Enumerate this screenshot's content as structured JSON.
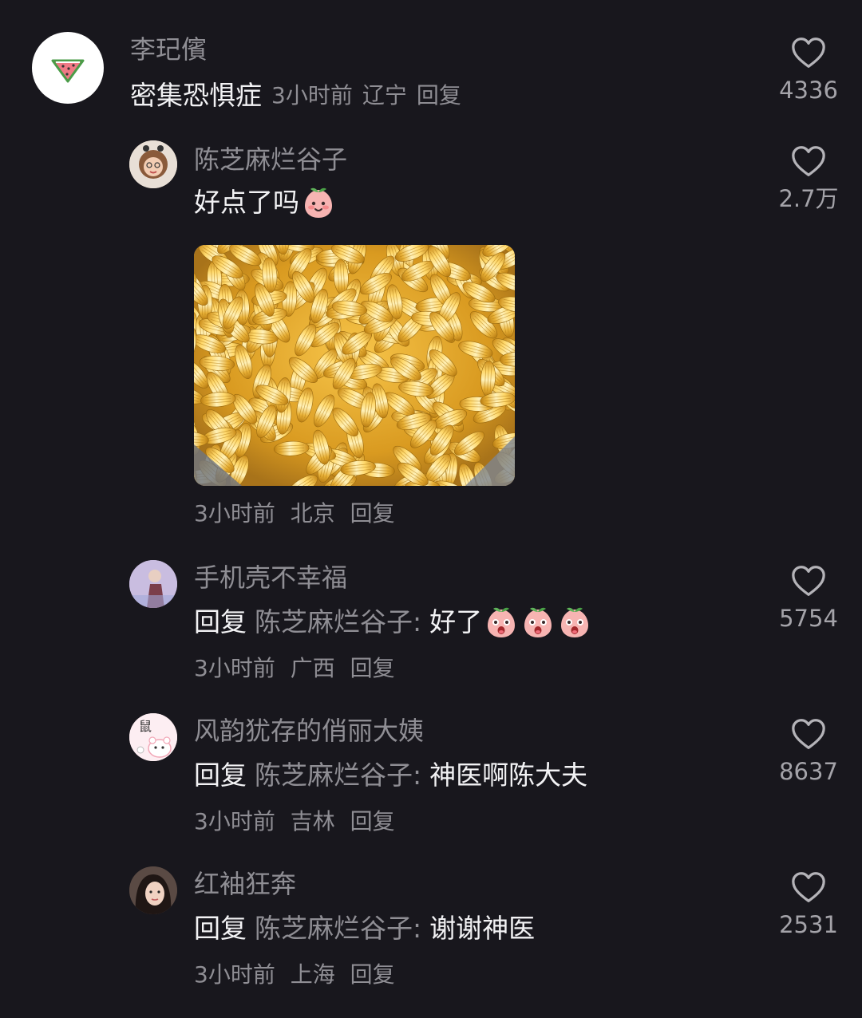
{
  "comments": [
    {
      "username": "李玘儐",
      "text": "密集恐惧症",
      "time": "3小时前",
      "location": "辽宁",
      "reply_label": "回复",
      "likes": "4336",
      "avatar_icon": "watermelon-icon"
    },
    {
      "username": "陈芝麻烂谷子",
      "text": "好点了吗",
      "time": "3小时前",
      "location": "北京",
      "reply_label": "回复",
      "likes": "2.7万",
      "emoji": "peach-face-emoji",
      "image": "golden-sunflower-seeds-photo"
    },
    {
      "username": "手机壳不幸福",
      "reply_prefix": "回复",
      "reply_to": "陈芝麻烂谷子:",
      "text": "好了",
      "time": "3小时前",
      "location": "广西",
      "reply_label": "回复",
      "likes": "5754",
      "emoji_count": 3
    },
    {
      "username": "风韵犹存的俏丽大姨",
      "reply_prefix": "回复",
      "reply_to": "陈芝麻烂谷子:",
      "text": "神医啊陈大夫",
      "time": "3小时前",
      "location": "吉林",
      "reply_label": "回复",
      "likes": "8637",
      "avatar_text": "鼠"
    },
    {
      "username": "红袖狂奔",
      "reply_prefix": "回复",
      "reply_to": "陈芝麻烂谷子:",
      "text": "谢谢神医",
      "time": "3小时前",
      "location": "上海",
      "reply_label": "回复",
      "likes": "2531"
    }
  ],
  "colors": {
    "background": "#18171d",
    "primary_text": "#f2f2f4",
    "secondary_text": "#8f8e94"
  }
}
